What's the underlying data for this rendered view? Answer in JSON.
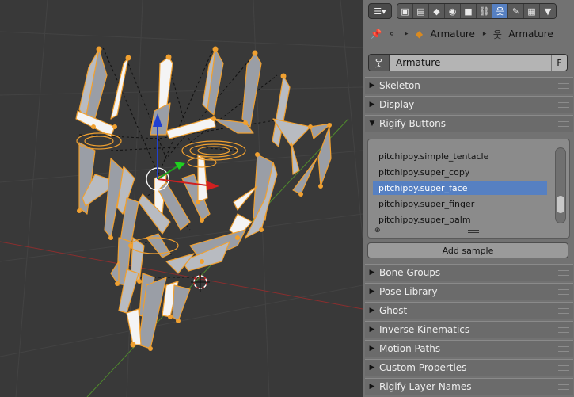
{
  "header": {
    "editor_type_icon": "properties-icon",
    "context_tabs": [
      {
        "name": "render-icon",
        "glyph": "▣"
      },
      {
        "name": "render-layers-icon",
        "glyph": "▤"
      },
      {
        "name": "scene-icon",
        "glyph": "◆"
      },
      {
        "name": "world-icon",
        "glyph": "◉"
      },
      {
        "name": "object-icon",
        "glyph": "■"
      },
      {
        "name": "constraints-icon",
        "glyph": "⛓"
      },
      {
        "name": "armature-data-icon",
        "glyph": "웃",
        "active": true
      },
      {
        "name": "bone-icon",
        "glyph": "✎"
      },
      {
        "name": "bone-constraints-icon",
        "glyph": "▦"
      },
      {
        "name": "texture-icon",
        "glyph": "▼"
      }
    ]
  },
  "breadcrumb": {
    "object_label": "Armature",
    "data_label": "Armature"
  },
  "datablock": {
    "name": "Armature",
    "fake_user": "F"
  },
  "sections": {
    "skeleton": "Skeleton",
    "display": "Display",
    "rigify_buttons": "Rigify Buttons",
    "bone_groups": "Bone Groups",
    "pose_library": "Pose Library",
    "ghost": "Ghost",
    "inverse_kinematics": "Inverse Kinematics",
    "motion_paths": "Motion Paths",
    "custom_properties": "Custom Properties",
    "rigify_layer_names": "Rigify Layer Names"
  },
  "rigify": {
    "samples": [
      "pitchipoy.simple_tentacle",
      "pitchipoy.super_copy",
      "pitchipoy.super_face",
      "pitchipoy.super_finger",
      "pitchipoy.super_palm"
    ],
    "selected_index": 2,
    "add_sample_label": "Add sample"
  },
  "colors": {
    "bone_outline": "#f0a030",
    "bone_face": "#9a9ea6",
    "bone_light": "#f4f4f4",
    "selection_blue": "#5680c2",
    "axis_red": "#a83030",
    "axis_green": "#4f8a2c"
  }
}
